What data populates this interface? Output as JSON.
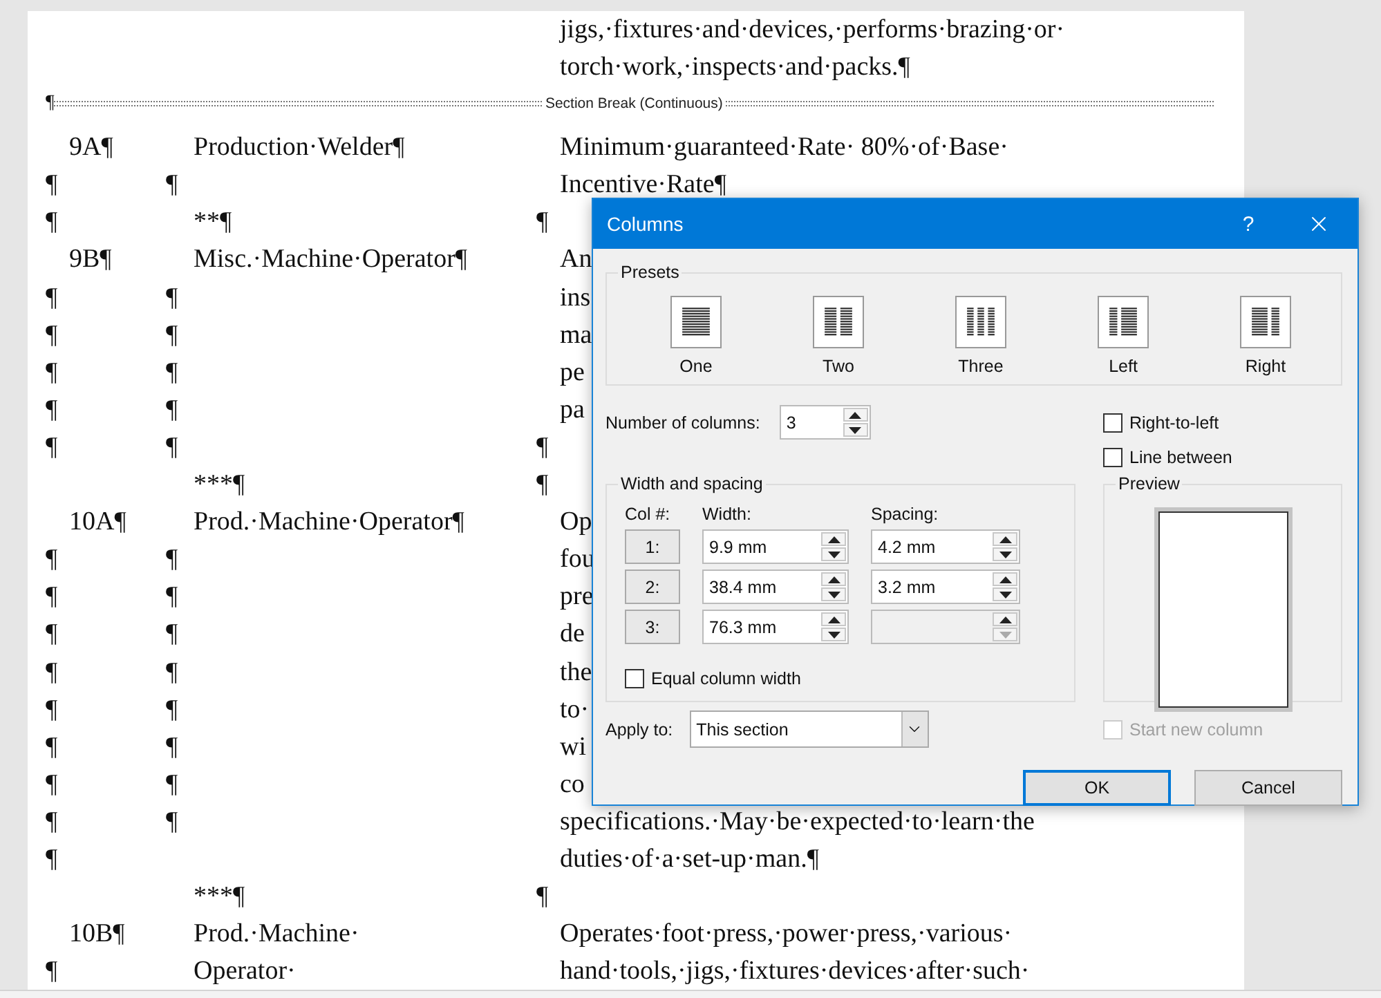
{
  "document": {
    "blocks": [
      {
        "kind": "line",
        "text": "jigs,·fixtures·and·devices,·performs·brazing·or·"
      },
      {
        "kind": "line",
        "text": "torch·work,·inspects·and·packs.¶"
      },
      {
        "kind": "section_break",
        "mark": "¶",
        "label": "Section Break (Continuous)"
      },
      {
        "kind": "line",
        "code": "9A¶",
        "title": "Production·Welder¶",
        "text": "Minimum·guaranteed·Rate· 80%·of·Base·"
      },
      {
        "kind": "line",
        "mark_1": "¶",
        "mark_2": "¶",
        "text": "Incentive·Rate¶"
      },
      {
        "kind": "line",
        "mark_1": "¶",
        "title": "**¶",
        "mark_3": "¶"
      },
      {
        "kind": "line",
        "code": "9B¶",
        "title": "Misc.·Machine·Operator¶",
        "text": "An"
      },
      {
        "kind": "line",
        "mark_1": "¶",
        "mark_2": "¶",
        "text": "ins"
      },
      {
        "kind": "line",
        "mark_1": "¶",
        "mark_2": "¶",
        "text": "ma"
      },
      {
        "kind": "line",
        "mark_1": "¶",
        "mark_2": "¶",
        "text": "pe"
      },
      {
        "kind": "line",
        "mark_1": "¶",
        "mark_2": "¶",
        "text": "pa"
      },
      {
        "kind": "line",
        "mark_1": "¶",
        "mark_2": "¶",
        "mark_3": "¶"
      },
      {
        "kind": "line",
        "title": "***¶",
        "mark_3": "¶"
      },
      {
        "kind": "line",
        "code": "10A¶",
        "title": "Prod.·Machine·Operator¶",
        "text": "Op"
      },
      {
        "kind": "line",
        "mark_1": "¶",
        "mark_2": "¶",
        "text": "fou"
      },
      {
        "kind": "line",
        "mark_1": "¶",
        "mark_2": "¶",
        "text": "pre"
      },
      {
        "kind": "line",
        "mark_1": "¶",
        "mark_2": "¶",
        "text": "de"
      },
      {
        "kind": "line",
        "mark_1": "¶",
        "mark_2": "¶",
        "text": "the"
      },
      {
        "kind": "line",
        "mark_1": "¶",
        "mark_2": "¶",
        "text": "to·"
      },
      {
        "kind": "line",
        "mark_1": "¶",
        "mark_2": "¶",
        "text": "wi"
      },
      {
        "kind": "line",
        "mark_1": "¶",
        "mark_2": "¶",
        "text": "co"
      },
      {
        "kind": "line",
        "mark_1": "¶",
        "mark_2": "¶",
        "text": "specifications.·May·be·expected·to·learn·the"
      },
      {
        "kind": "line",
        "mark_1": "¶",
        "text": "duties·of·a·set-up·man.¶"
      },
      {
        "kind": "line",
        "title": "***¶",
        "mark_3": "¶"
      },
      {
        "kind": "line",
        "code": "10B¶",
        "title": "Prod.·Machine·",
        "text": "Operates·foot·press,·power·press,·various·"
      },
      {
        "kind": "line",
        "mark_1": "¶",
        "title": "Operator·",
        "text": "hand·tools,·jigs,·fixtures·devices·after·such·"
      }
    ]
  },
  "dialog": {
    "title": "Columns",
    "help": "?",
    "presets": {
      "label": "Presets",
      "items": [
        {
          "kind": "one",
          "label": "One",
          "selected": false
        },
        {
          "kind": "two",
          "label": "Two",
          "selected": false
        },
        {
          "kind": "three",
          "label": "Three",
          "selected": false
        },
        {
          "kind": "left",
          "label": "Left",
          "selected": false
        },
        {
          "kind": "right",
          "label": "Right",
          "selected": false
        }
      ]
    },
    "number_of_columns": {
      "label": "Number of columns:",
      "value": "3"
    },
    "right_to_left": {
      "label": "Right-to-left",
      "checked": false
    },
    "line_between": {
      "label": "Line between",
      "checked": false
    },
    "width_and_spacing": {
      "label": "Width and spacing",
      "headers": [
        "Col #:",
        "Width:",
        "Spacing:"
      ],
      "rows": [
        {
          "col": "1:",
          "width": "9.9 mm",
          "spacing": "4.2 mm",
          "spacing_disabled": false
        },
        {
          "col": "2:",
          "width": "38.4 mm",
          "spacing": "3.2 mm",
          "spacing_disabled": false
        },
        {
          "col": "3:",
          "width": "76.3 mm",
          "spacing_disabled": true
        }
      ]
    },
    "equal_column_width": {
      "label": "Equal column width",
      "checked": false
    },
    "preview": {
      "label": "Preview"
    },
    "apply_to": {
      "label": "Apply to:",
      "value": "This section"
    },
    "start_new_column": {
      "label": "Start new column",
      "checked": false,
      "disabled": true
    },
    "buttons": [
      {
        "label": "OK",
        "default": true
      },
      {
        "label": "Cancel",
        "default": false
      }
    ]
  }
}
